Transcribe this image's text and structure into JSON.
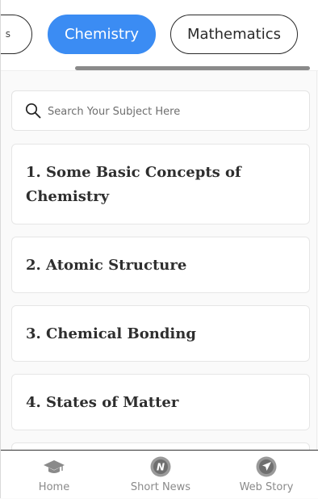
{
  "tabs": {
    "previous_label": "s",
    "active_label": "Chemistry",
    "next_label": "Mathematics"
  },
  "search": {
    "placeholder": "Search Your Subject Here",
    "value": ""
  },
  "chapters": [
    {
      "label": "1. Some Basic Concepts of Chemistry"
    },
    {
      "label": "2. Atomic Structure"
    },
    {
      "label": "3. Chemical Bonding"
    },
    {
      "label": "4. States of Matter"
    }
  ],
  "bottom_nav": [
    {
      "label": "Home",
      "icon": "graduation-cap-icon"
    },
    {
      "label": "Short News",
      "icon": "news-n-icon"
    },
    {
      "label": "Web Story",
      "icon": "paper-plane-icon"
    }
  ],
  "colors": {
    "accent": "#3b8cf3",
    "text": "#2e2e2e",
    "muted": "#8a8a8a"
  }
}
